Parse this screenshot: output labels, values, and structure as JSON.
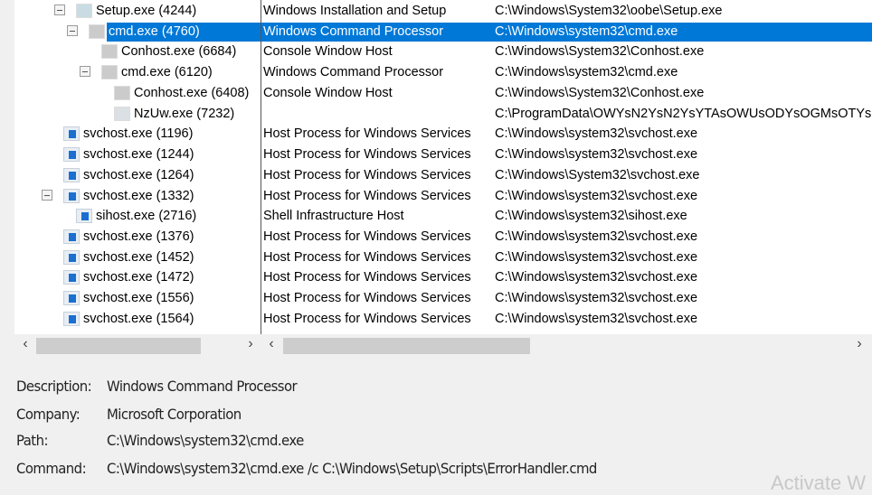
{
  "processes": [
    {
      "name": "Setup.exe (4244)",
      "description": "Windows Installation and Setup",
      "path": "C:\\Windows\\System32\\oobe\\Setup.exe",
      "level": 1,
      "icon": "setup-icon",
      "expanded": true,
      "selected": false
    },
    {
      "name": "cmd.exe (4760)",
      "description": "Windows Command Processor",
      "path": "C:\\Windows\\system32\\cmd.exe",
      "level": 2,
      "icon": "console-icon",
      "expanded": true,
      "selected": true
    },
    {
      "name": "Conhost.exe (6684)",
      "description": "Console Window Host",
      "path": "C:\\Windows\\System32\\Conhost.exe",
      "level": 3,
      "icon": "console-icon",
      "expanded": null,
      "selected": false
    },
    {
      "name": "cmd.exe (6120)",
      "description": "Windows Command Processor",
      "path": "C:\\Windows\\system32\\cmd.exe",
      "level": 3,
      "icon": "console-icon",
      "expanded": true,
      "selected": false
    },
    {
      "name": "Conhost.exe (6408)",
      "description": "Console Window Host",
      "path": "C:\\Windows\\System32\\Conhost.exe",
      "level": 4,
      "icon": "console-icon",
      "expanded": null,
      "selected": false
    },
    {
      "name": "NzUw.exe (7232)",
      "description": "",
      "path": "C:\\ProgramData\\OWYsN2YsN2YsYTAsOWUsODYsOGMsOTYs",
      "level": 4,
      "icon": "generic-exe-icon",
      "expanded": null,
      "selected": false
    },
    {
      "name": "svchost.exe (1196)",
      "description": "Host Process for Windows Services",
      "path": "C:\\Windows\\system32\\svchost.exe",
      "level": 0,
      "icon": "service-icon",
      "expanded": null,
      "selected": false
    },
    {
      "name": "svchost.exe (1244)",
      "description": "Host Process for Windows Services",
      "path": "C:\\Windows\\system32\\svchost.exe",
      "level": 0,
      "icon": "service-icon",
      "expanded": null,
      "selected": false
    },
    {
      "name": "svchost.exe (1264)",
      "description": "Host Process for Windows Services",
      "path": "C:\\Windows\\System32\\svchost.exe",
      "level": 0,
      "icon": "service-icon",
      "expanded": null,
      "selected": false
    },
    {
      "name": "svchost.exe (1332)",
      "description": "Host Process for Windows Services",
      "path": "C:\\Windows\\system32\\svchost.exe",
      "level": 0,
      "icon": "service-icon",
      "expanded": true,
      "selected": false
    },
    {
      "name": "sihost.exe (2716)",
      "description": "Shell Infrastructure Host",
      "path": "C:\\Windows\\system32\\sihost.exe",
      "level": 1,
      "icon": "service-icon",
      "expanded": null,
      "selected": false
    },
    {
      "name": "svchost.exe (1376)",
      "description": "Host Process for Windows Services",
      "path": "C:\\Windows\\system32\\svchost.exe",
      "level": 0,
      "icon": "service-icon",
      "expanded": null,
      "selected": false
    },
    {
      "name": "svchost.exe (1452)",
      "description": "Host Process for Windows Services",
      "path": "C:\\Windows\\system32\\svchost.exe",
      "level": 0,
      "icon": "service-icon",
      "expanded": null,
      "selected": false
    },
    {
      "name": "svchost.exe (1472)",
      "description": "Host Process for Windows Services",
      "path": "C:\\Windows\\system32\\svchost.exe",
      "level": 0,
      "icon": "service-icon",
      "expanded": null,
      "selected": false
    },
    {
      "name": "svchost.exe (1556)",
      "description": "Host Process for Windows Services",
      "path": "C:\\Windows\\system32\\svchost.exe",
      "level": 0,
      "icon": "service-icon",
      "expanded": null,
      "selected": false
    },
    {
      "name": "svchost.exe (1564)",
      "description": "Host Process for Windows Services",
      "path": "C:\\Windows\\system32\\svchost.exe",
      "level": 0,
      "icon": "service-icon",
      "expanded": null,
      "selected": false
    }
  ],
  "details": {
    "description_label": "Description:",
    "description": "Windows Command Processor",
    "company_label": "Company:",
    "company": "Microsoft Corporation",
    "path_label": "Path:",
    "path": "C:\\Windows\\system32\\cmd.exe",
    "command_label": "Command:",
    "command": "C:\\Windows\\system32\\cmd.exe /c C:\\Windows\\Setup\\Scripts\\ErrorHandler.cmd"
  },
  "scroll": {
    "left_arrow": "‹",
    "right_arrow": "›"
  },
  "watermark": "Activate W",
  "colors": {
    "selection": "#0078d7",
    "service_icon": "#1a6fd0"
  }
}
